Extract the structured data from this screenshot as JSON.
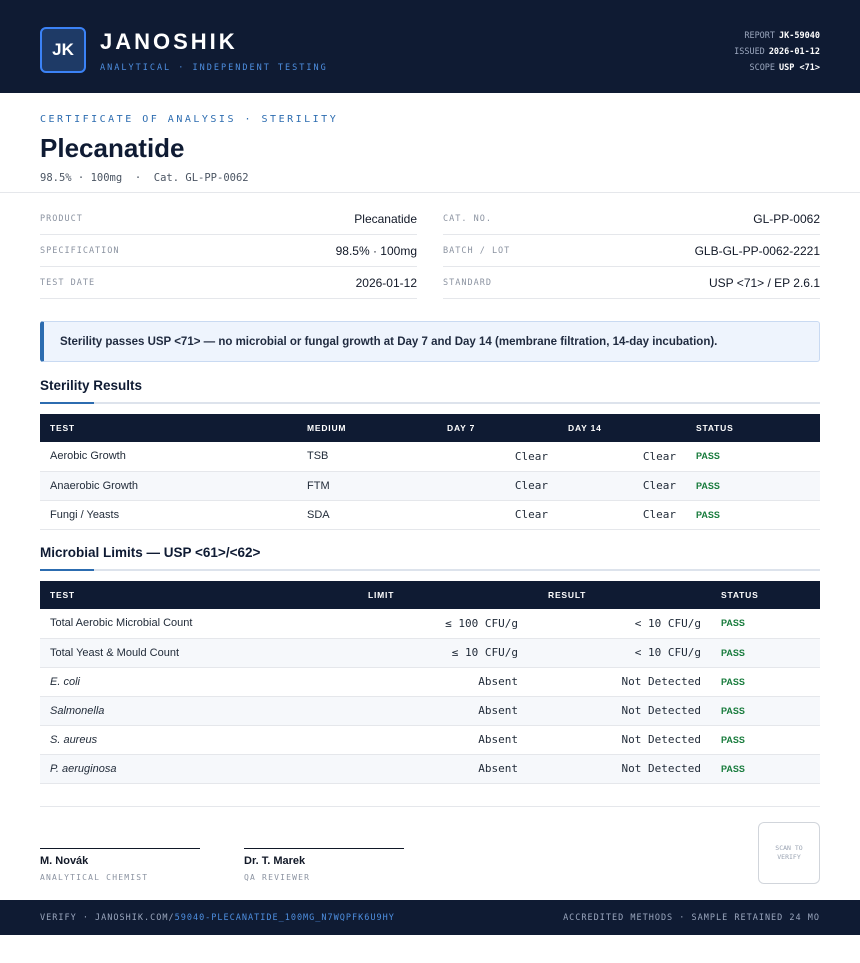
{
  "header": {
    "logo_initials": "JK",
    "brand": "JANOSHIK",
    "tagline": "ANALYTICAL · INDEPENDENT TESTING",
    "meta": [
      {
        "label": "REPORT",
        "value": "JK-59040"
      },
      {
        "label": "ISSUED",
        "value": "2026-01-12"
      },
      {
        "label": "SCOPE",
        "value": "USP <71>"
      }
    ]
  },
  "title_block": {
    "eyebrow": "CERTIFICATE OF ANALYSIS · STERILITY",
    "title": "Plecanatide",
    "subtitle": "98.5% · 100mg  ·  Cat. GL-PP-0062"
  },
  "info_left": [
    {
      "label": "PRODUCT",
      "value": "Plecanatide"
    },
    {
      "label": "SPECIFICATION",
      "value": "98.5% · 100mg"
    },
    {
      "label": "TEST DATE",
      "value": "2026-01-12"
    }
  ],
  "info_right": [
    {
      "label": "CAT. NO.",
      "value": "GL-PP-0062"
    },
    {
      "label": "BATCH / LOT",
      "value": "GLB-GL-PP-0062-2221"
    },
    {
      "label": "STANDARD",
      "value": "USP <71> / EP 2.6.1"
    }
  ],
  "notice": "Sterility passes USP <71> — no microbial or fungal growth at Day 7 and Day 14 (membrane filtration, 14-day incubation).",
  "sterility": {
    "heading": "Sterility Results",
    "columns": [
      "TEST",
      "MEDIUM",
      "DAY 7",
      "DAY 14",
      "STATUS"
    ],
    "rows": [
      {
        "test": "Aerobic Growth",
        "medium": "TSB",
        "day7": "Clear",
        "day14": "Clear",
        "status": "PASS"
      },
      {
        "test": "Anaerobic Growth",
        "medium": "FTM",
        "day7": "Clear",
        "day14": "Clear",
        "status": "PASS"
      },
      {
        "test": "Fungi / Yeasts",
        "medium": "SDA",
        "day7": "Clear",
        "day14": "Clear",
        "status": "PASS"
      }
    ]
  },
  "microbial": {
    "heading": "Microbial Limits — USP <61>/<62>",
    "columns": [
      "TEST",
      "LIMIT",
      "RESULT",
      "STATUS"
    ],
    "rows": [
      {
        "test": "Total Aerobic Microbial Count",
        "limit": "≤ 100 CFU/g",
        "result": "< 10 CFU/g",
        "status": "PASS"
      },
      {
        "test": "Total Yeast & Mould Count",
        "limit": "≤ 10 CFU/g",
        "result": "< 10 CFU/g",
        "status": "PASS"
      },
      {
        "test": "E. coli",
        "limit": "Absent",
        "result": "Not Detected",
        "status": "PASS"
      },
      {
        "test": "Salmonella",
        "limit": "Absent",
        "result": "Not Detected",
        "status": "PASS"
      },
      {
        "test": "S. aureus",
        "limit": "Absent",
        "result": "Not Detected",
        "status": "PASS"
      },
      {
        "test": "P. aeruginosa",
        "limit": "Absent",
        "result": "Not Detected",
        "status": "PASS"
      }
    ]
  },
  "signatures": [
    {
      "name": "M. Novák",
      "role": "ANALYTICAL CHEMIST"
    },
    {
      "name": "Dr. T. Marek",
      "role": "QA REVIEWER"
    }
  ],
  "qr_label": "SCAN TO VERIFY",
  "footer": {
    "verify_prefix": "VERIFY · JANOSHIK.COM/",
    "verify_link": "59040-PLECANATIDE_100MG_N7WQPFK6U9HY",
    "right": "ACCREDITED METHODS · SAMPLE RETAINED 24 MO"
  }
}
